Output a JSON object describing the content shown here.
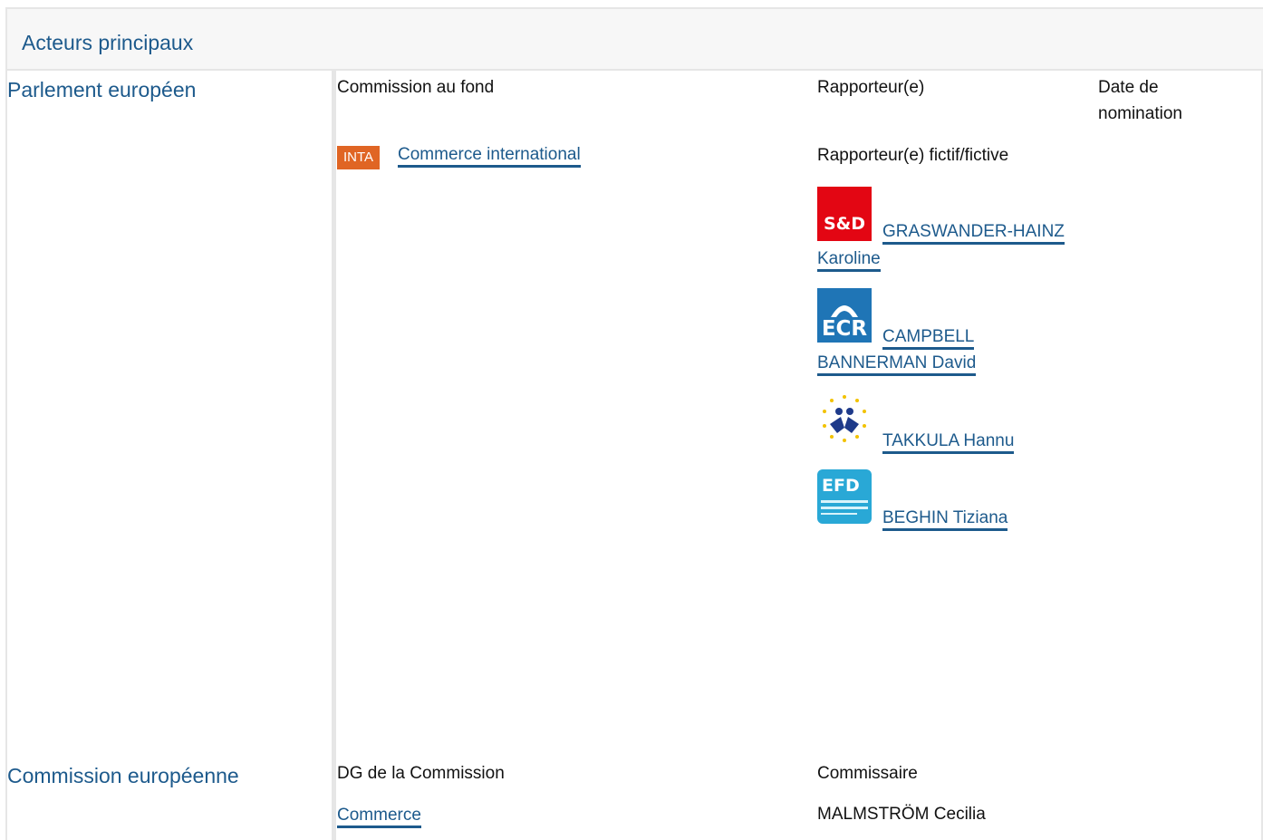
{
  "header": {
    "title": "Acteurs principaux"
  },
  "parliament": {
    "label": "Parlement européen",
    "col_committee": "Commission au fond",
    "col_rapporteur": "Rapporteur(e)",
    "col_date": "Date de nomination",
    "committee_badge": "INTA",
    "committee_name": "Commerce international",
    "shadow_heading": "Rapporteur(e) fictif/fictive",
    "shadows": [
      {
        "group": "S&D",
        "logo_icon": "sd-group-logo-icon",
        "name_line1": "GRASWANDER-HAINZ",
        "name_line2": "Karoline"
      },
      {
        "group": "ECR",
        "logo_icon": "ecr-group-logo-icon",
        "name_line1": "CAMPBELL",
        "name_line2": "BANNERMAN David"
      },
      {
        "group": "ALDE",
        "logo_icon": "alde-group-logo-icon",
        "name_line1": "TAKKULA Hannu",
        "name_line2": ""
      },
      {
        "group": "EFD",
        "logo_icon": "efd-group-logo-icon",
        "name_line1": "BEGHIN Tiziana",
        "name_line2": ""
      }
    ]
  },
  "commission": {
    "label": "Commission européenne",
    "col_dg": "DG de la Commission",
    "col_commissioner": "Commissaire",
    "dg_name": "Commerce",
    "commissioner_name": "MALMSTRÖM Cecilia"
  },
  "colors": {
    "link": "#1d5a8c",
    "badge": "#e06524",
    "divider": "#e6e6e6"
  }
}
